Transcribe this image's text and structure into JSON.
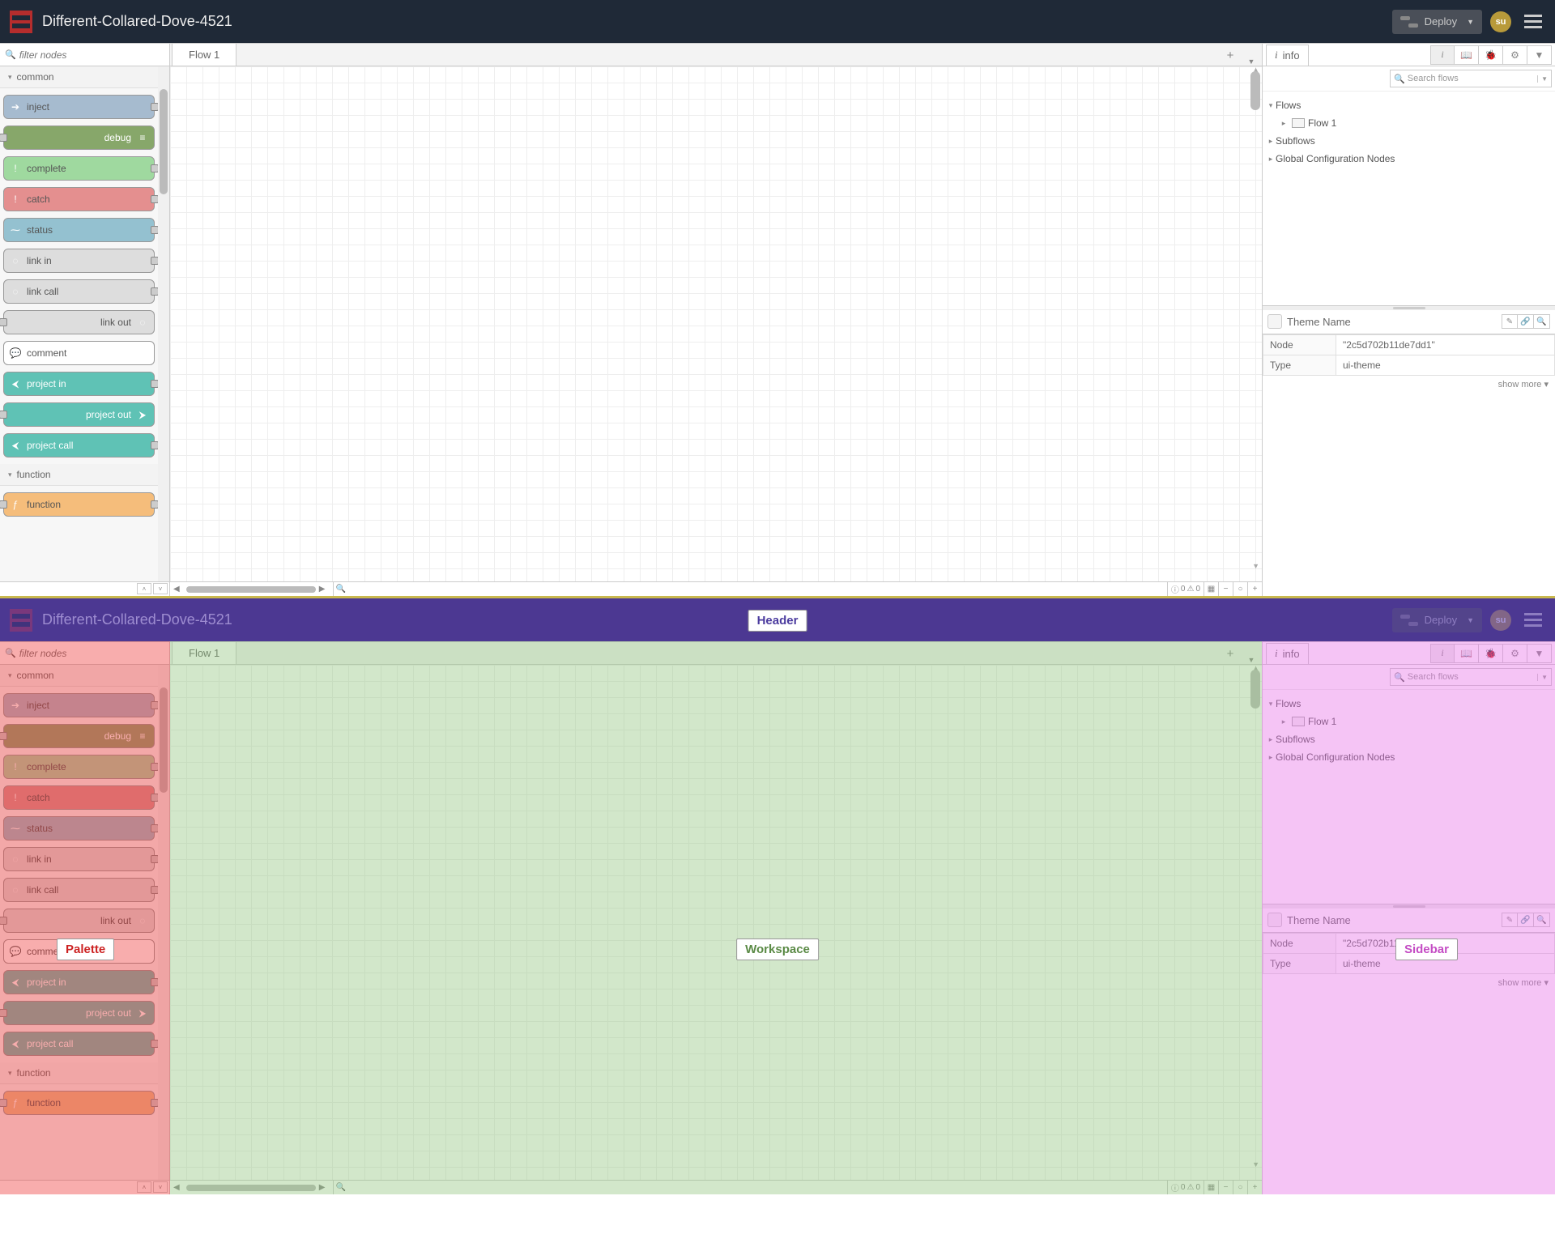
{
  "header": {
    "title": "Different-Collared-Dove-4521",
    "deploy_label": "Deploy",
    "avatar_initials": "su"
  },
  "palette": {
    "filter_placeholder": "filter nodes",
    "categories": [
      {
        "name": "common",
        "nodes": [
          {
            "key": "inject",
            "label": "inject"
          },
          {
            "key": "debug",
            "label": "debug"
          },
          {
            "key": "complete",
            "label": "complete"
          },
          {
            "key": "catch",
            "label": "catch"
          },
          {
            "key": "status",
            "label": "status"
          },
          {
            "key": "link-in",
            "label": "link in"
          },
          {
            "key": "link-call",
            "label": "link call"
          },
          {
            "key": "link-out",
            "label": "link out"
          },
          {
            "key": "comment",
            "label": "comment"
          },
          {
            "key": "project-in",
            "label": "project in"
          },
          {
            "key": "project-out",
            "label": "project out"
          },
          {
            "key": "project-call",
            "label": "project call"
          }
        ]
      },
      {
        "name": "function",
        "nodes": [
          {
            "key": "function",
            "label": "function"
          }
        ]
      }
    ]
  },
  "workspace": {
    "tabs": [
      "Flow 1"
    ],
    "footer": {
      "info_count": "0",
      "warn_count": "0"
    }
  },
  "sidebar": {
    "tab_label": "info",
    "search_placeholder": "Search flows",
    "tree": {
      "flows_label": "Flows",
      "flow_items": [
        "Flow 1"
      ],
      "subflows_label": "Subflows",
      "global_label": "Global Configuration Nodes"
    },
    "panel": {
      "title": "Theme Name",
      "rows": [
        {
          "k": "Node",
          "v": "\"2c5d702b11de7dd1\""
        },
        {
          "k": "Type",
          "v": "ui-theme"
        }
      ],
      "show_more": "show more ▾"
    }
  },
  "annotations": {
    "header": "Header",
    "palette": "Palette",
    "workspace": "Workspace",
    "sidebar": "Sidebar"
  }
}
